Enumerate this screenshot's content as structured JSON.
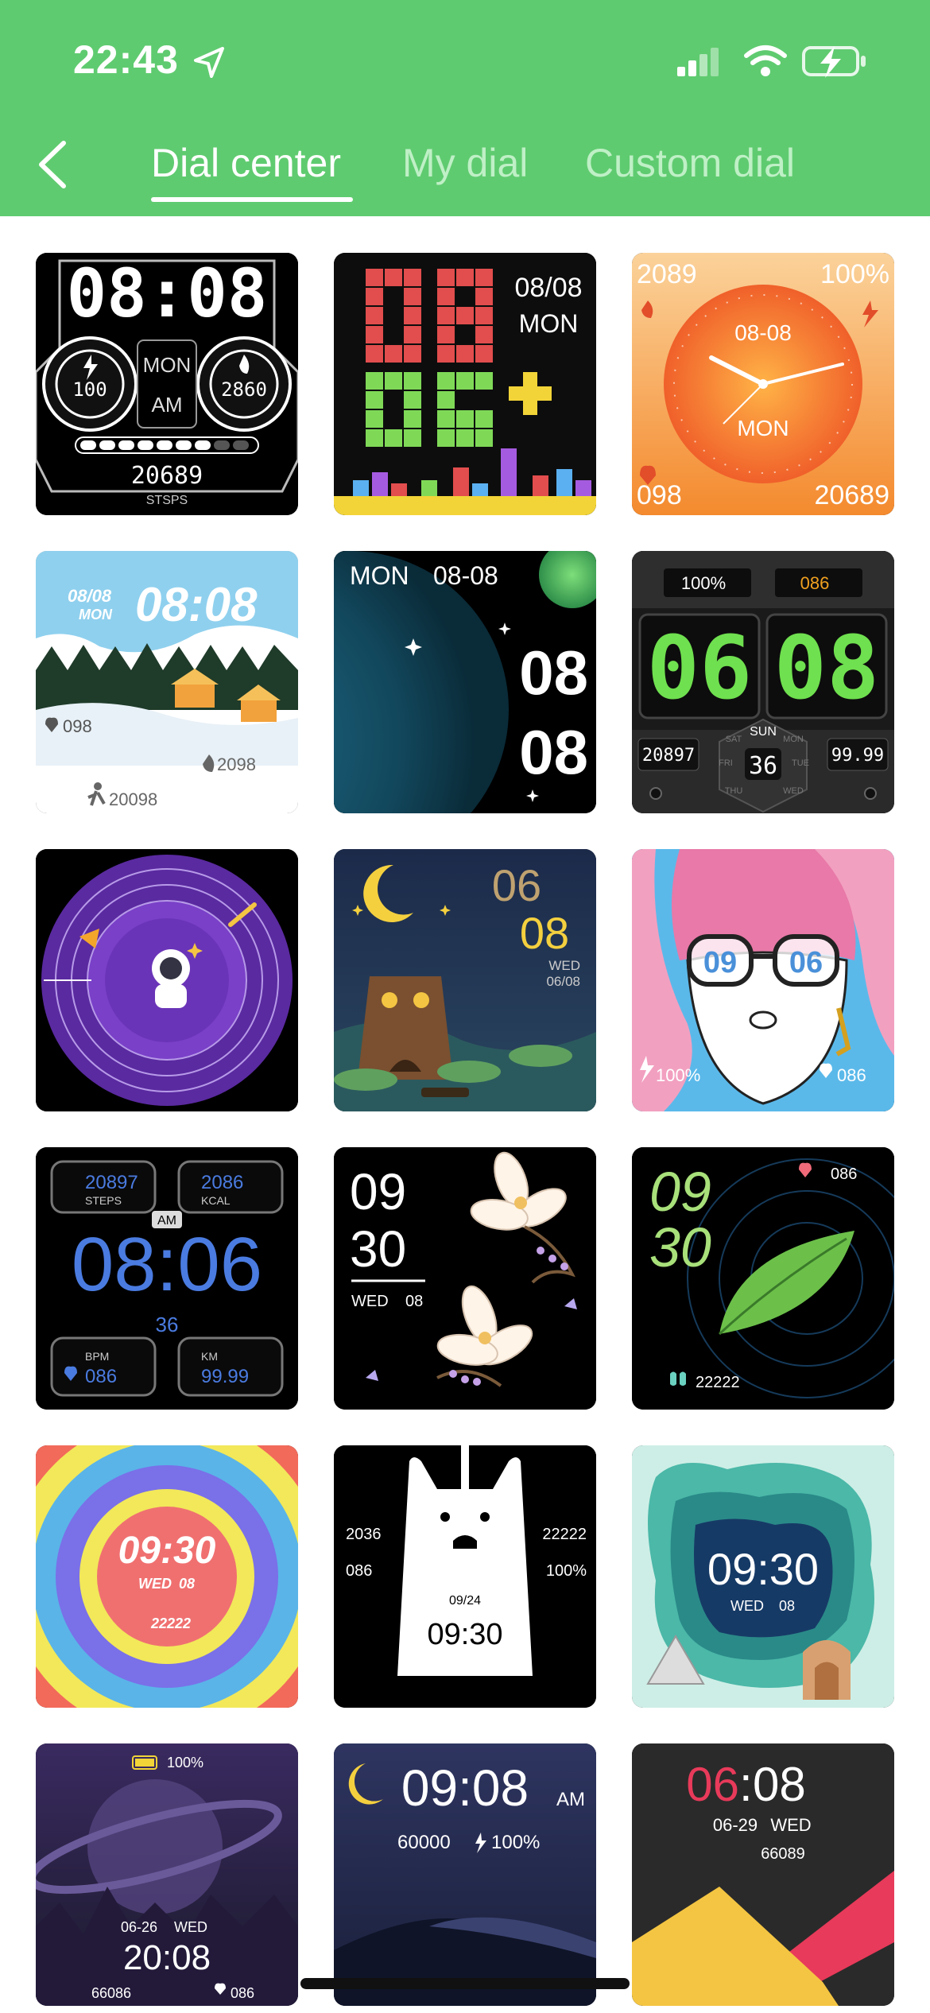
{
  "status_bar": {
    "time": "22:43"
  },
  "header": {
    "tabs": [
      {
        "label": "Dial center",
        "active": true
      },
      {
        "label": "My dial",
        "active": false
      },
      {
        "label": "Custom dial",
        "active": false
      }
    ]
  },
  "colors": {
    "header_green": "#5fcb70",
    "tab_inactive": "#bff0c6"
  },
  "dials": [
    {
      "time": "08:08",
      "day": "MON",
      "period": "AM",
      "left_gauge": "100",
      "right_gauge": "2860",
      "steps": "20689",
      "steps_label": "STSPS"
    },
    {
      "hour": "08",
      "minute": "06",
      "date": "08/08",
      "day": "MON"
    },
    {
      "top_left": "2089",
      "top_right": "100%",
      "date": "08-08",
      "day": "MON",
      "bottom_left": "098",
      "bottom_right": "20689"
    },
    {
      "date": "08/08",
      "day": "MON",
      "time": "08:08",
      "heart": "098",
      "calories": "2098",
      "steps": "20098"
    },
    {
      "day": "MON",
      "date": "08-08",
      "hour": "08",
      "minute": "08"
    },
    {
      "battery": "100%",
      "value": "086",
      "hour": "06",
      "minute": "08",
      "left": "20897",
      "day": "SUN",
      "center": "36",
      "right": "99.99",
      "ring_days": [
        "SAT",
        "MON",
        "FRI",
        "TUE",
        "THU",
        "WED"
      ]
    },
    {
      "name": "astronaut-moon"
    },
    {
      "hour": "06",
      "minute": "08",
      "day": "WED",
      "date": "06/08"
    },
    {
      "hour": "09",
      "minute": "06",
      "battery": "100%",
      "heart": "086"
    },
    {
      "steps": "20897",
      "steps_label": "STEPS",
      "kcal": "2086",
      "kcal_label": "KCAL",
      "period": "AM",
      "time": "08:06",
      "seconds": "36",
      "bpm_label": "BPM",
      "bpm": "086",
      "km_label": "KM",
      "km": "99.99"
    },
    {
      "hour": "09",
      "minute": "30",
      "day": "WED",
      "date": "08"
    },
    {
      "hour": "09",
      "minute": "30",
      "heart": "086",
      "steps": "22222"
    },
    {
      "time": "09:30",
      "day": "WED",
      "date": "08",
      "steps": "22222"
    },
    {
      "left_top": "2036",
      "left_bottom": "086",
      "right_top": "22222",
      "right_bottom": "100%",
      "date": "09/24",
      "time": "09:30"
    },
    {
      "time": "09:30",
      "day": "WED",
      "date": "08"
    },
    {
      "battery": "100%",
      "date": "06-26",
      "day": "WED",
      "time": "20:08",
      "steps": "66086",
      "heart": "086"
    },
    {
      "time": "09:08",
      "period": "AM",
      "steps": "60000",
      "battery": "100%"
    },
    {
      "hour": "06",
      "minute": "08",
      "date": "06-29",
      "day": "WED",
      "steps": "66089"
    }
  ]
}
